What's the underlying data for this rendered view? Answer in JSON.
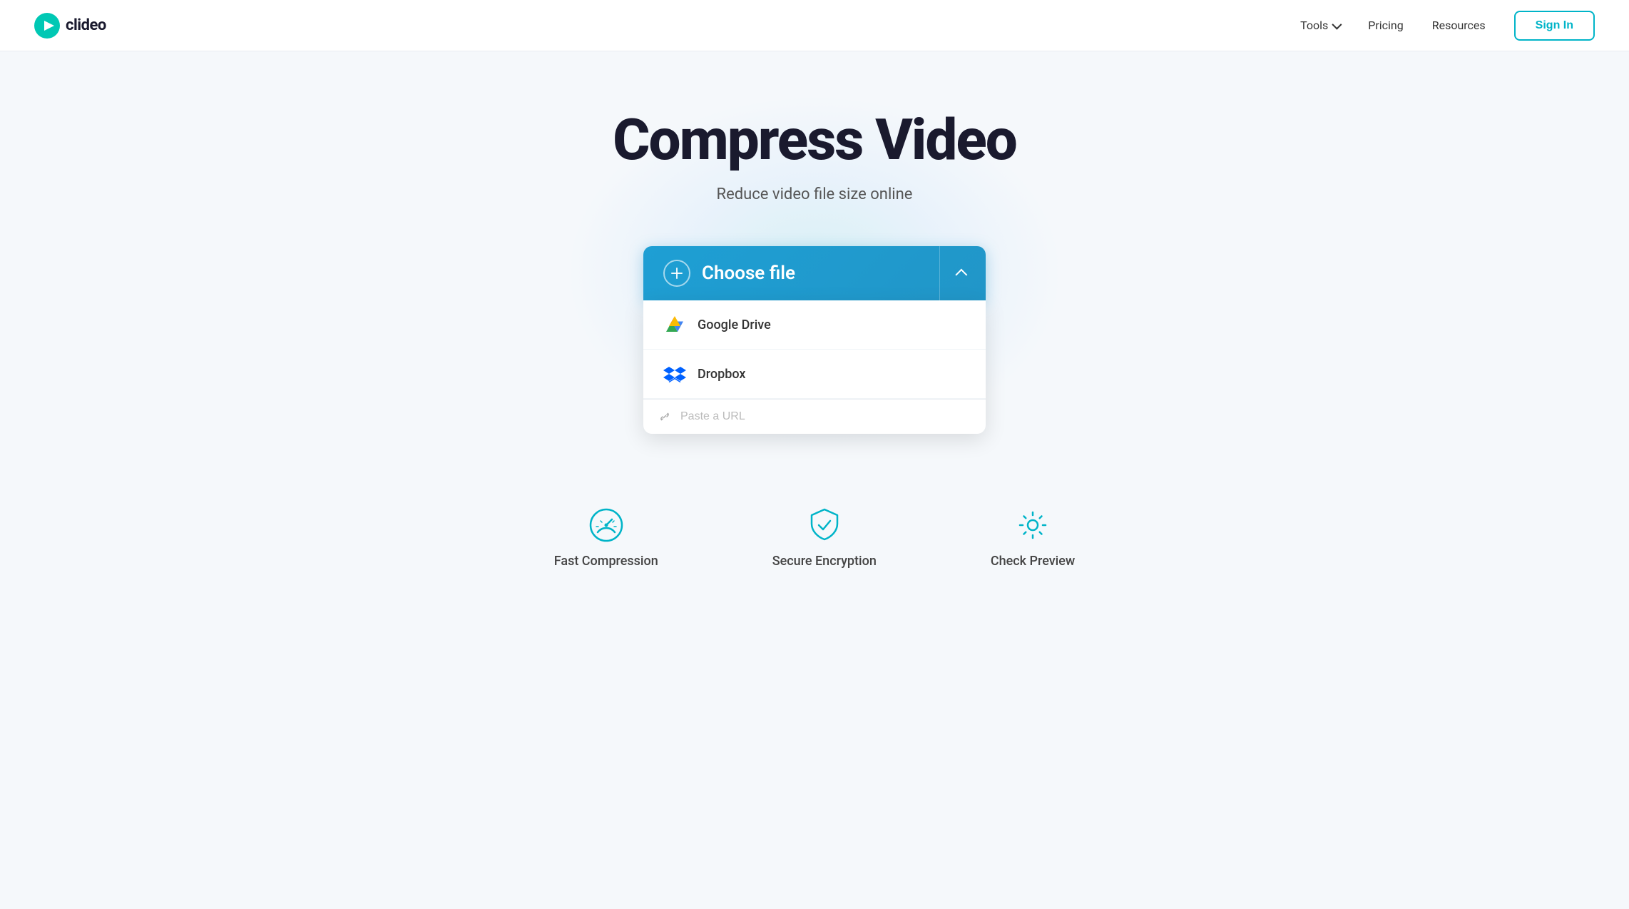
{
  "brand": {
    "name": "clideo",
    "logo_alt": "Clideo logo"
  },
  "nav": {
    "tools_label": "Tools",
    "pricing_label": "Pricing",
    "resources_label": "Resources",
    "sign_in_label": "Sign In"
  },
  "hero": {
    "title": "Compress Video",
    "subtitle": "Reduce video file size online"
  },
  "upload": {
    "choose_file_label": "Choose file",
    "google_drive_label": "Google Drive",
    "dropbox_label": "Dropbox",
    "url_placeholder": "Paste a URL"
  },
  "features": [
    {
      "id": "fast-compression",
      "icon": "speedometer-icon",
      "label": "Fast Compression"
    },
    {
      "id": "secure-encryption",
      "icon": "shield-icon",
      "label": "Secure Encryption"
    },
    {
      "id": "check-preview",
      "icon": "gear-icon",
      "label": "Check Preview"
    }
  ]
}
